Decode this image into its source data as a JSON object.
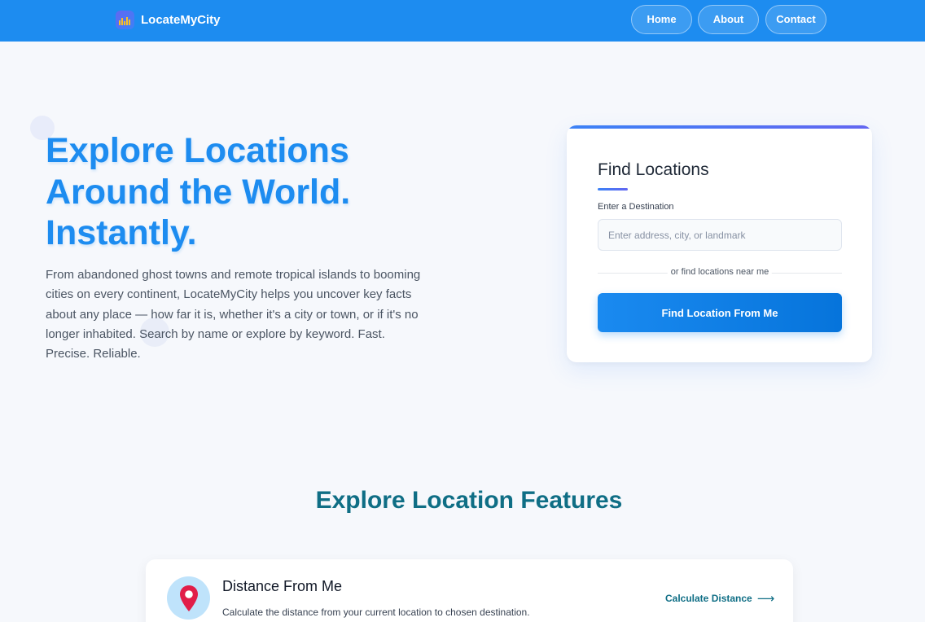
{
  "header": {
    "brand": "LocateMyCity",
    "nav": [
      {
        "label": "Home"
      },
      {
        "label": "About"
      },
      {
        "label": "Contact"
      }
    ]
  },
  "hero": {
    "title_lines": [
      "Explore Locations",
      "Around the World.",
      "Instantly."
    ],
    "description": "From abandoned ghost towns and remote tropical islands to booming cities on every continent, LocateMyCity helps you uncover key facts about any place — how far it is, whether it's a city or town, or if it's no longer inhabited. Search by name or explore by keyword. Fast. Precise. Reliable."
  },
  "find_card": {
    "title": "Find Locations",
    "input_label": "Enter a Destination",
    "input_value": "",
    "input_placeholder": "Enter address, city, or landmark",
    "divider_text": "or find locations near me",
    "button_label": "Find Location From Me"
  },
  "features": {
    "title": "Explore Location Features",
    "items": [
      {
        "icon": "map-pin-icon",
        "title": "Distance From Me",
        "description": "Calculate the distance from your current location to chosen destination.",
        "link_label": "Calculate Distance",
        "link_icon": "arrow-right-icon"
      }
    ]
  },
  "colors": {
    "header_bg": "#1d8cf0",
    "accent": "#1d8cf0",
    "features_title": "#0f6e85",
    "pin": "#e11d48"
  }
}
